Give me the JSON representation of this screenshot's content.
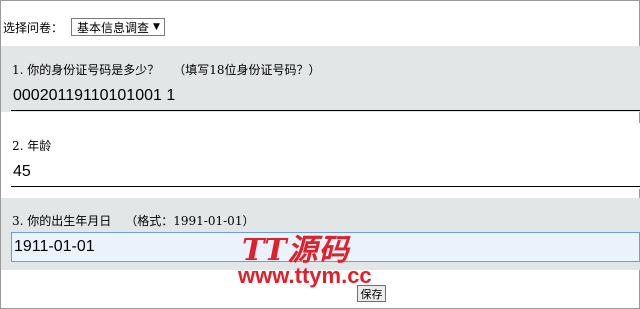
{
  "selector": {
    "label": "选择问卷：",
    "selected_value": "基本信息调查"
  },
  "questions": [
    {
      "label": "1. 你的身份证号码是多少？",
      "hint": "（填写18位身份证号码？）",
      "value": "00020119110101001 1"
    },
    {
      "label": "2. 年龄",
      "hint": "",
      "value": "45"
    },
    {
      "label": "3. 你的出生年月日",
      "hint": "（格式：1991-01-01）",
      "value": "1911-01-01"
    }
  ],
  "save_button": {
    "label": "保存"
  },
  "watermark": {
    "logo": "TT源码",
    "url": "www.ttym.cc"
  },
  "colors": {
    "row_gray": "#e3e6e6",
    "focus_border": "#6d9ed6",
    "watermark_red": "#e0202a"
  }
}
